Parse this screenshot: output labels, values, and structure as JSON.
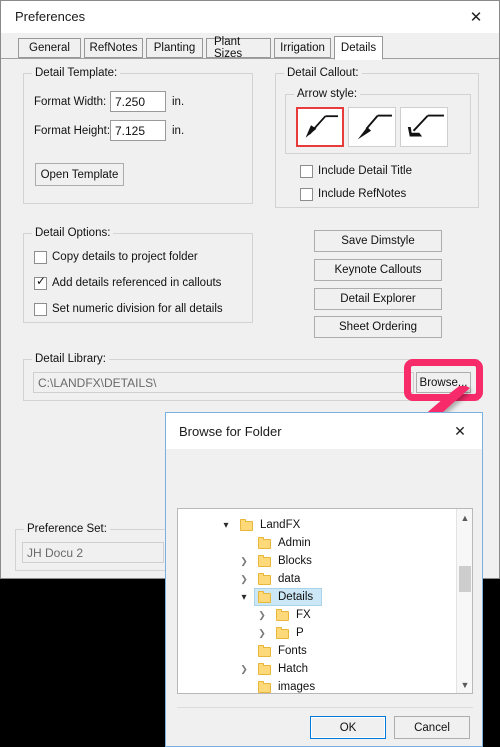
{
  "preferences": {
    "title": "Preferences",
    "close_icon": "close-icon",
    "tabs": [
      {
        "label": "General",
        "active": false
      },
      {
        "label": "RefNotes",
        "active": false
      },
      {
        "label": "Planting",
        "active": false
      },
      {
        "label": "Plant Sizes",
        "active": false
      },
      {
        "label": "Irrigation",
        "active": false
      },
      {
        "label": "Details",
        "active": true
      }
    ],
    "detail_template": {
      "legend": "Detail Template:",
      "format_width_label": "Format Width:",
      "format_width_value": "7.250",
      "format_width_unit": "in.",
      "format_height_label": "Format Height:",
      "format_height_value": "7.125",
      "format_height_unit": "in.",
      "open_template_label": "Open Template"
    },
    "detail_callout": {
      "legend": "Detail Callout:",
      "arrow_style_legend": "Arrow style:",
      "arrow_styles": [
        {
          "name": "arrow-style-filled-icon",
          "selected": true
        },
        {
          "name": "arrow-style-tapered-icon",
          "selected": false
        },
        {
          "name": "arrow-style-bent-icon",
          "selected": false
        }
      ],
      "include_detail_title_label": "Include Detail Title",
      "include_detail_title_checked": false,
      "include_refnotes_label": "Include RefNotes",
      "include_refnotes_checked": false
    },
    "detail_options": {
      "legend": "Detail Options:",
      "items": [
        {
          "label": "Copy details to project folder",
          "checked": false
        },
        {
          "label": "Add details referenced in callouts",
          "checked": true
        },
        {
          "label": "Set numeric division for all details",
          "checked": false
        }
      ]
    },
    "action_buttons": [
      {
        "label": "Save Dimstyle"
      },
      {
        "label": "Keynote Callouts"
      },
      {
        "label": "Detail Explorer"
      },
      {
        "label": "Sheet Ordering"
      }
    ],
    "detail_library": {
      "legend": "Detail Library:",
      "path_value": "C:\\LANDFX\\DETAILS\\",
      "browse_label": "Browse..."
    },
    "preference_set": {
      "legend": "Preference Set:",
      "value": "JH Docu 2"
    }
  },
  "annotation": {
    "highlight_color": "#f72a6a",
    "target": "browse-button"
  },
  "browse_dialog": {
    "title": "Browse for Folder",
    "close_icon": "close-icon",
    "tree": [
      {
        "label": "LandFX",
        "depth": 0,
        "state": "expanded",
        "selected": false
      },
      {
        "label": "Admin",
        "depth": 1,
        "state": "leaf",
        "selected": false
      },
      {
        "label": "Blocks",
        "depth": 1,
        "state": "collapsed",
        "selected": false
      },
      {
        "label": "data",
        "depth": 1,
        "state": "collapsed",
        "selected": false
      },
      {
        "label": "Details",
        "depth": 1,
        "state": "expanded",
        "selected": true
      },
      {
        "label": "FX",
        "depth": 2,
        "state": "collapsed",
        "selected": false
      },
      {
        "label": "P",
        "depth": 2,
        "state": "collapsed",
        "selected": false
      },
      {
        "label": "Fonts",
        "depth": 1,
        "state": "leaf",
        "selected": false
      },
      {
        "label": "Hatch",
        "depth": 1,
        "state": "collapsed",
        "selected": false
      },
      {
        "label": "images",
        "depth": 1,
        "state": "leaf",
        "selected": false
      }
    ],
    "ok_label": "OK",
    "cancel_label": "Cancel"
  }
}
